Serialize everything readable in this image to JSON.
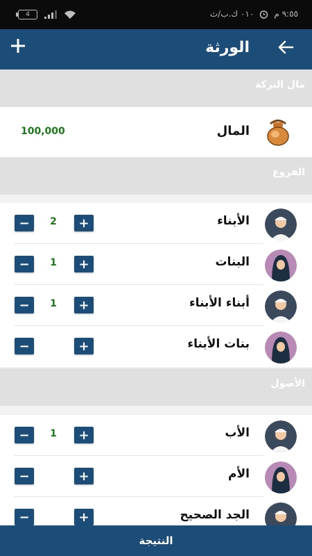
{
  "status_bar": {
    "time": "٩:٥٥ م",
    "data_speed": "٠١٠ ك.ب/ث",
    "battery": "4"
  },
  "app_bar": {
    "title": "الورثة",
    "back_icon": "arrow-back-icon",
    "add_icon": "plus-icon"
  },
  "estate": {
    "header": "مال التركة",
    "label": "المال",
    "value": "100,000",
    "icon": "money-bag-icon"
  },
  "branches": {
    "header": "الفروع",
    "items": [
      {
        "label": "الأبناء",
        "count": "2",
        "avatar": "male-avatar-icon"
      },
      {
        "label": "البنات",
        "count": "1",
        "avatar": "female-avatar-icon"
      },
      {
        "label": "أبناء الأبناء",
        "count": "1",
        "avatar": "male-avatar-icon"
      },
      {
        "label": "بنات الأبناء",
        "count": "",
        "avatar": "female-avatar-icon"
      }
    ]
  },
  "roots": {
    "header": "الأصول",
    "items": [
      {
        "label": "الأب",
        "count": "1",
        "avatar": "male-avatar-icon"
      },
      {
        "label": "الأم",
        "count": "",
        "avatar": "female-avatar-icon"
      },
      {
        "label": "الجد الصحيح",
        "count": "",
        "avatar": "male-avatar-icon"
      }
    ]
  },
  "buttons": {
    "plus": "+",
    "minus": "−"
  },
  "bottom_bar": {
    "label": "النتيجة"
  },
  "colors": {
    "primary": "#1b4d78",
    "count_text": "#1a7a1a",
    "section_bg": "#e0e0e0"
  }
}
